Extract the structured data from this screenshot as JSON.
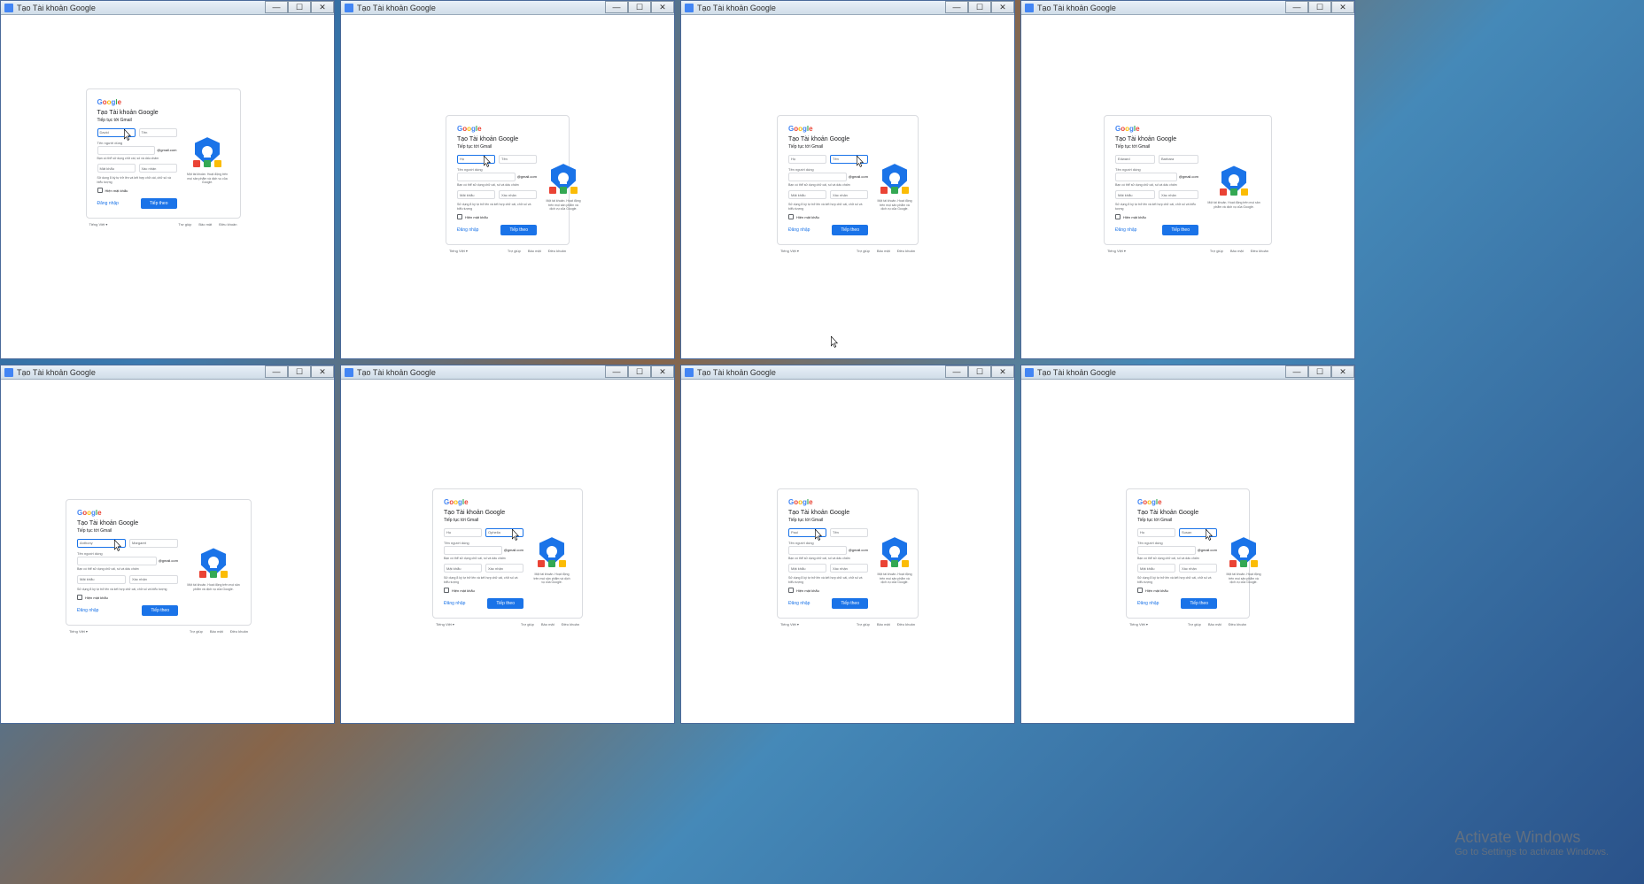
{
  "window_title": "Tạo Tài khoản Google",
  "card": {
    "heading": "Tạo Tài khoản Google",
    "subheading": "Tiếp tục tới Gmail",
    "first_name_label": "Họ",
    "last_name_label": "Tên",
    "username_label": "Tên người dùng",
    "username_suffix": "@gmail.com",
    "username_hint": "Bạn có thể sử dụng chữ cái, số và dấu chấm",
    "password_label": "Mật khẩu",
    "confirm_label": "Xác nhận",
    "password_hint": "Sử dụng 8 ký tự trở lên và kết hợp chữ cái, chữ số và biểu tượng",
    "show_password": "Hiện mật khẩu",
    "signin_link": "Đăng nhập",
    "next_button": "Tiếp theo",
    "hero_text": "Một tài khoản. Hoạt động trên mọi sản phẩm và dịch vụ của Google."
  },
  "footer": {
    "language": "Tiếng Việt",
    "help": "Trợ giúp",
    "privacy": "Bảo mật",
    "terms": "Điều khoản"
  },
  "windows": [
    {
      "first_name": "David",
      "last_name": "",
      "focus": "first"
    },
    {
      "first_name": "",
      "last_name": "",
      "focus": "first"
    },
    {
      "first_name": "",
      "last_name": "",
      "focus": "last"
    },
    {
      "first_name": "Edward",
      "last_name": "Barbara",
      "focus": ""
    },
    {
      "first_name": "Anthony",
      "last_name": "Margaret",
      "focus": "first"
    },
    {
      "first_name": "",
      "last_name": "Ophelia",
      "focus": "last"
    },
    {
      "first_name": "Paul",
      "last_name": "",
      "focus": "first"
    },
    {
      "first_name": "",
      "last_name": "Susan",
      "focus": "last"
    }
  ],
  "activate": {
    "title": "Activate Windows",
    "sub": "Go to Settings to activate Windows."
  }
}
